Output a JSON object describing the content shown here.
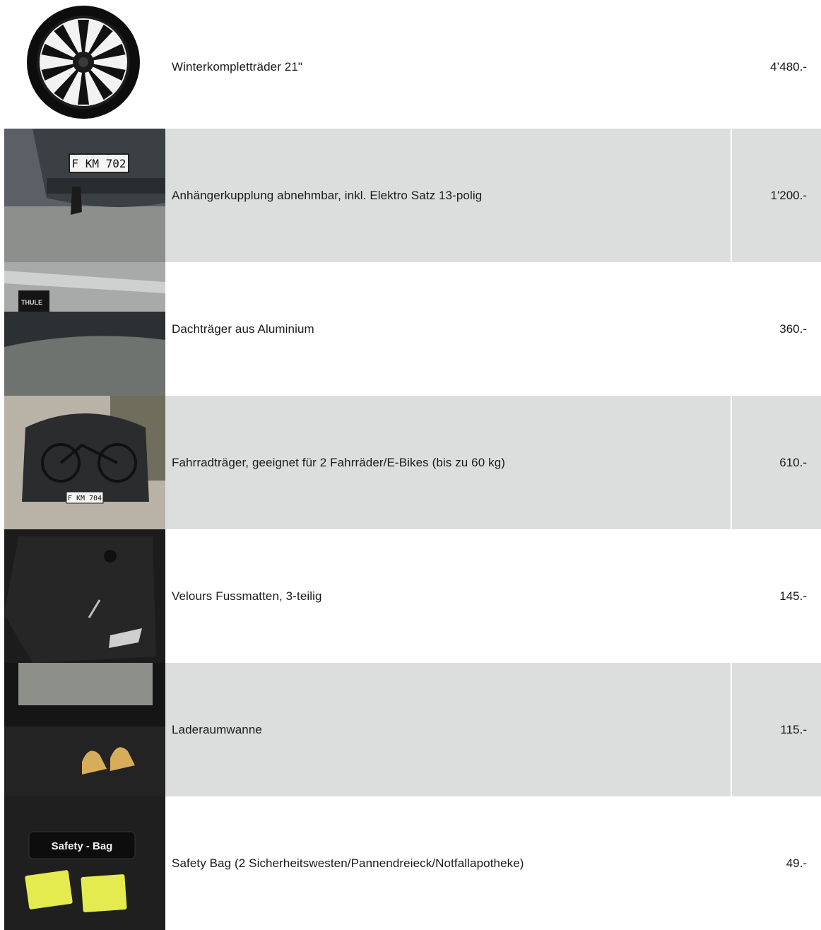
{
  "accessories": [
    {
      "icon": "wheel-image",
      "name": "Winterkompletträder 21\"",
      "price": "4’480.-"
    },
    {
      "icon": "tow-hitch-image",
      "name": "Anhängerkupplung abnehmbar, inkl. Elektro Satz 13-polig",
      "price": "1'200.-",
      "plate": "F KM 702"
    },
    {
      "icon": "roof-rack-image",
      "name": "Dachträger aus Aluminium",
      "price": "360.-",
      "brand_mark": "THULE"
    },
    {
      "icon": "bike-carrier-image",
      "name": "Fahrradträger, geeignet für 2 Fahrräder/E-Bikes (bis zu 60 kg)",
      "price": "610.-",
      "plate": "F KM 704"
    },
    {
      "icon": "floor-mats-image",
      "name": "Velours Fussmatten, 3-teilig",
      "price": "145.-"
    },
    {
      "icon": "trunk-tray-image",
      "name": "Laderaumwanne",
      "price": "115.-"
    },
    {
      "icon": "safety-bag-image",
      "name": "Safety Bag (2 Sicherheitswesten/Pannendreieck/Notfallapotheke)",
      "price": "49.-",
      "bag_label": "Safety - Bag"
    }
  ]
}
